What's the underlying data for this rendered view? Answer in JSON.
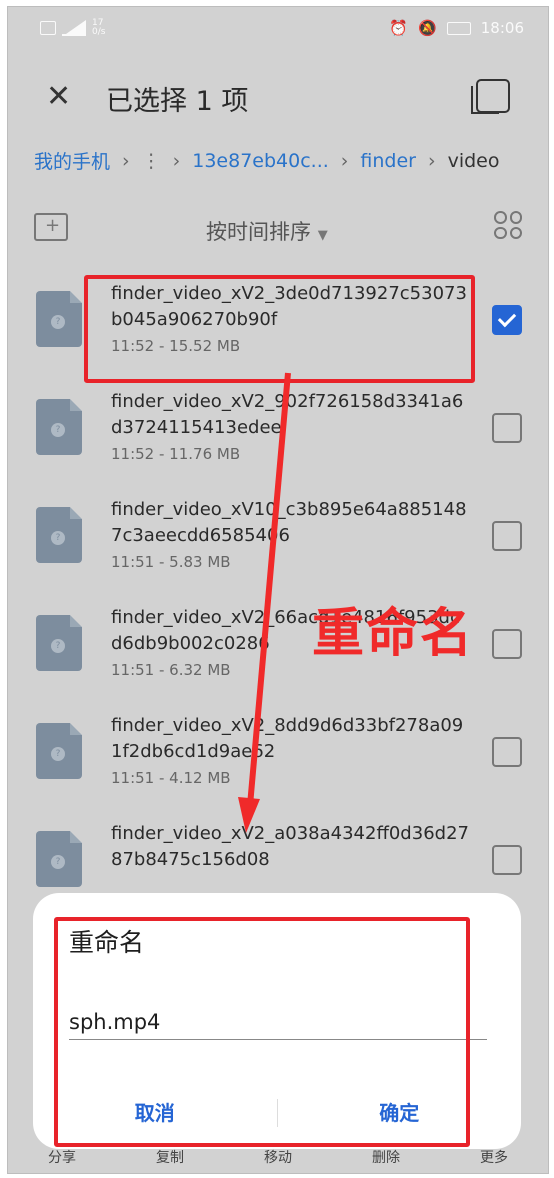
{
  "status": {
    "time": "18:06",
    "left_small": "17\n0/s"
  },
  "header": {
    "title": "已选择 1 项"
  },
  "breadcrumb": [
    "我的手机",
    "13e87eb40c...",
    "finder",
    "video"
  ],
  "sort_label": "按时间排序",
  "files": [
    {
      "name": "finder_video_xV2_3de0d713927c53073b045a906270b90f",
      "meta": "11:52 - 15.52 MB",
      "checked": true
    },
    {
      "name": "finder_video_xV2_902f726158d3341a6d3724115413edee",
      "meta": "11:52 - 11.76 MB",
      "checked": false
    },
    {
      "name": "finder_video_xV10_c3b895e64a8851487c3aeecdd6585406",
      "meta": "11:51 - 5.83 MB",
      "checked": false
    },
    {
      "name": "finder_video_xV2_66acd1e4816f953dcd6db9b002c0286",
      "meta": "11:51 - 6.32 MB",
      "checked": false
    },
    {
      "name": "finder_video_xV2_8dd9d6d33bf278a091f2db6cd1d9ae62",
      "meta": "11:51 - 4.12 MB",
      "checked": false
    },
    {
      "name": "finder_video_xV2_a038a4342ff0d36d2787b8475c156d08",
      "meta": "",
      "checked": false
    }
  ],
  "annotation": {
    "label": "重命名",
    "color": "#f02a2a"
  },
  "toolbar": [
    "分享",
    "复制",
    "移动",
    "删除",
    "更多"
  ],
  "dialog": {
    "title": "重命名",
    "value": "sph.mp4",
    "cancel": "取消",
    "ok": "确定"
  },
  "colors": {
    "accent": "#2565d4",
    "highlight": "#e8232a"
  }
}
